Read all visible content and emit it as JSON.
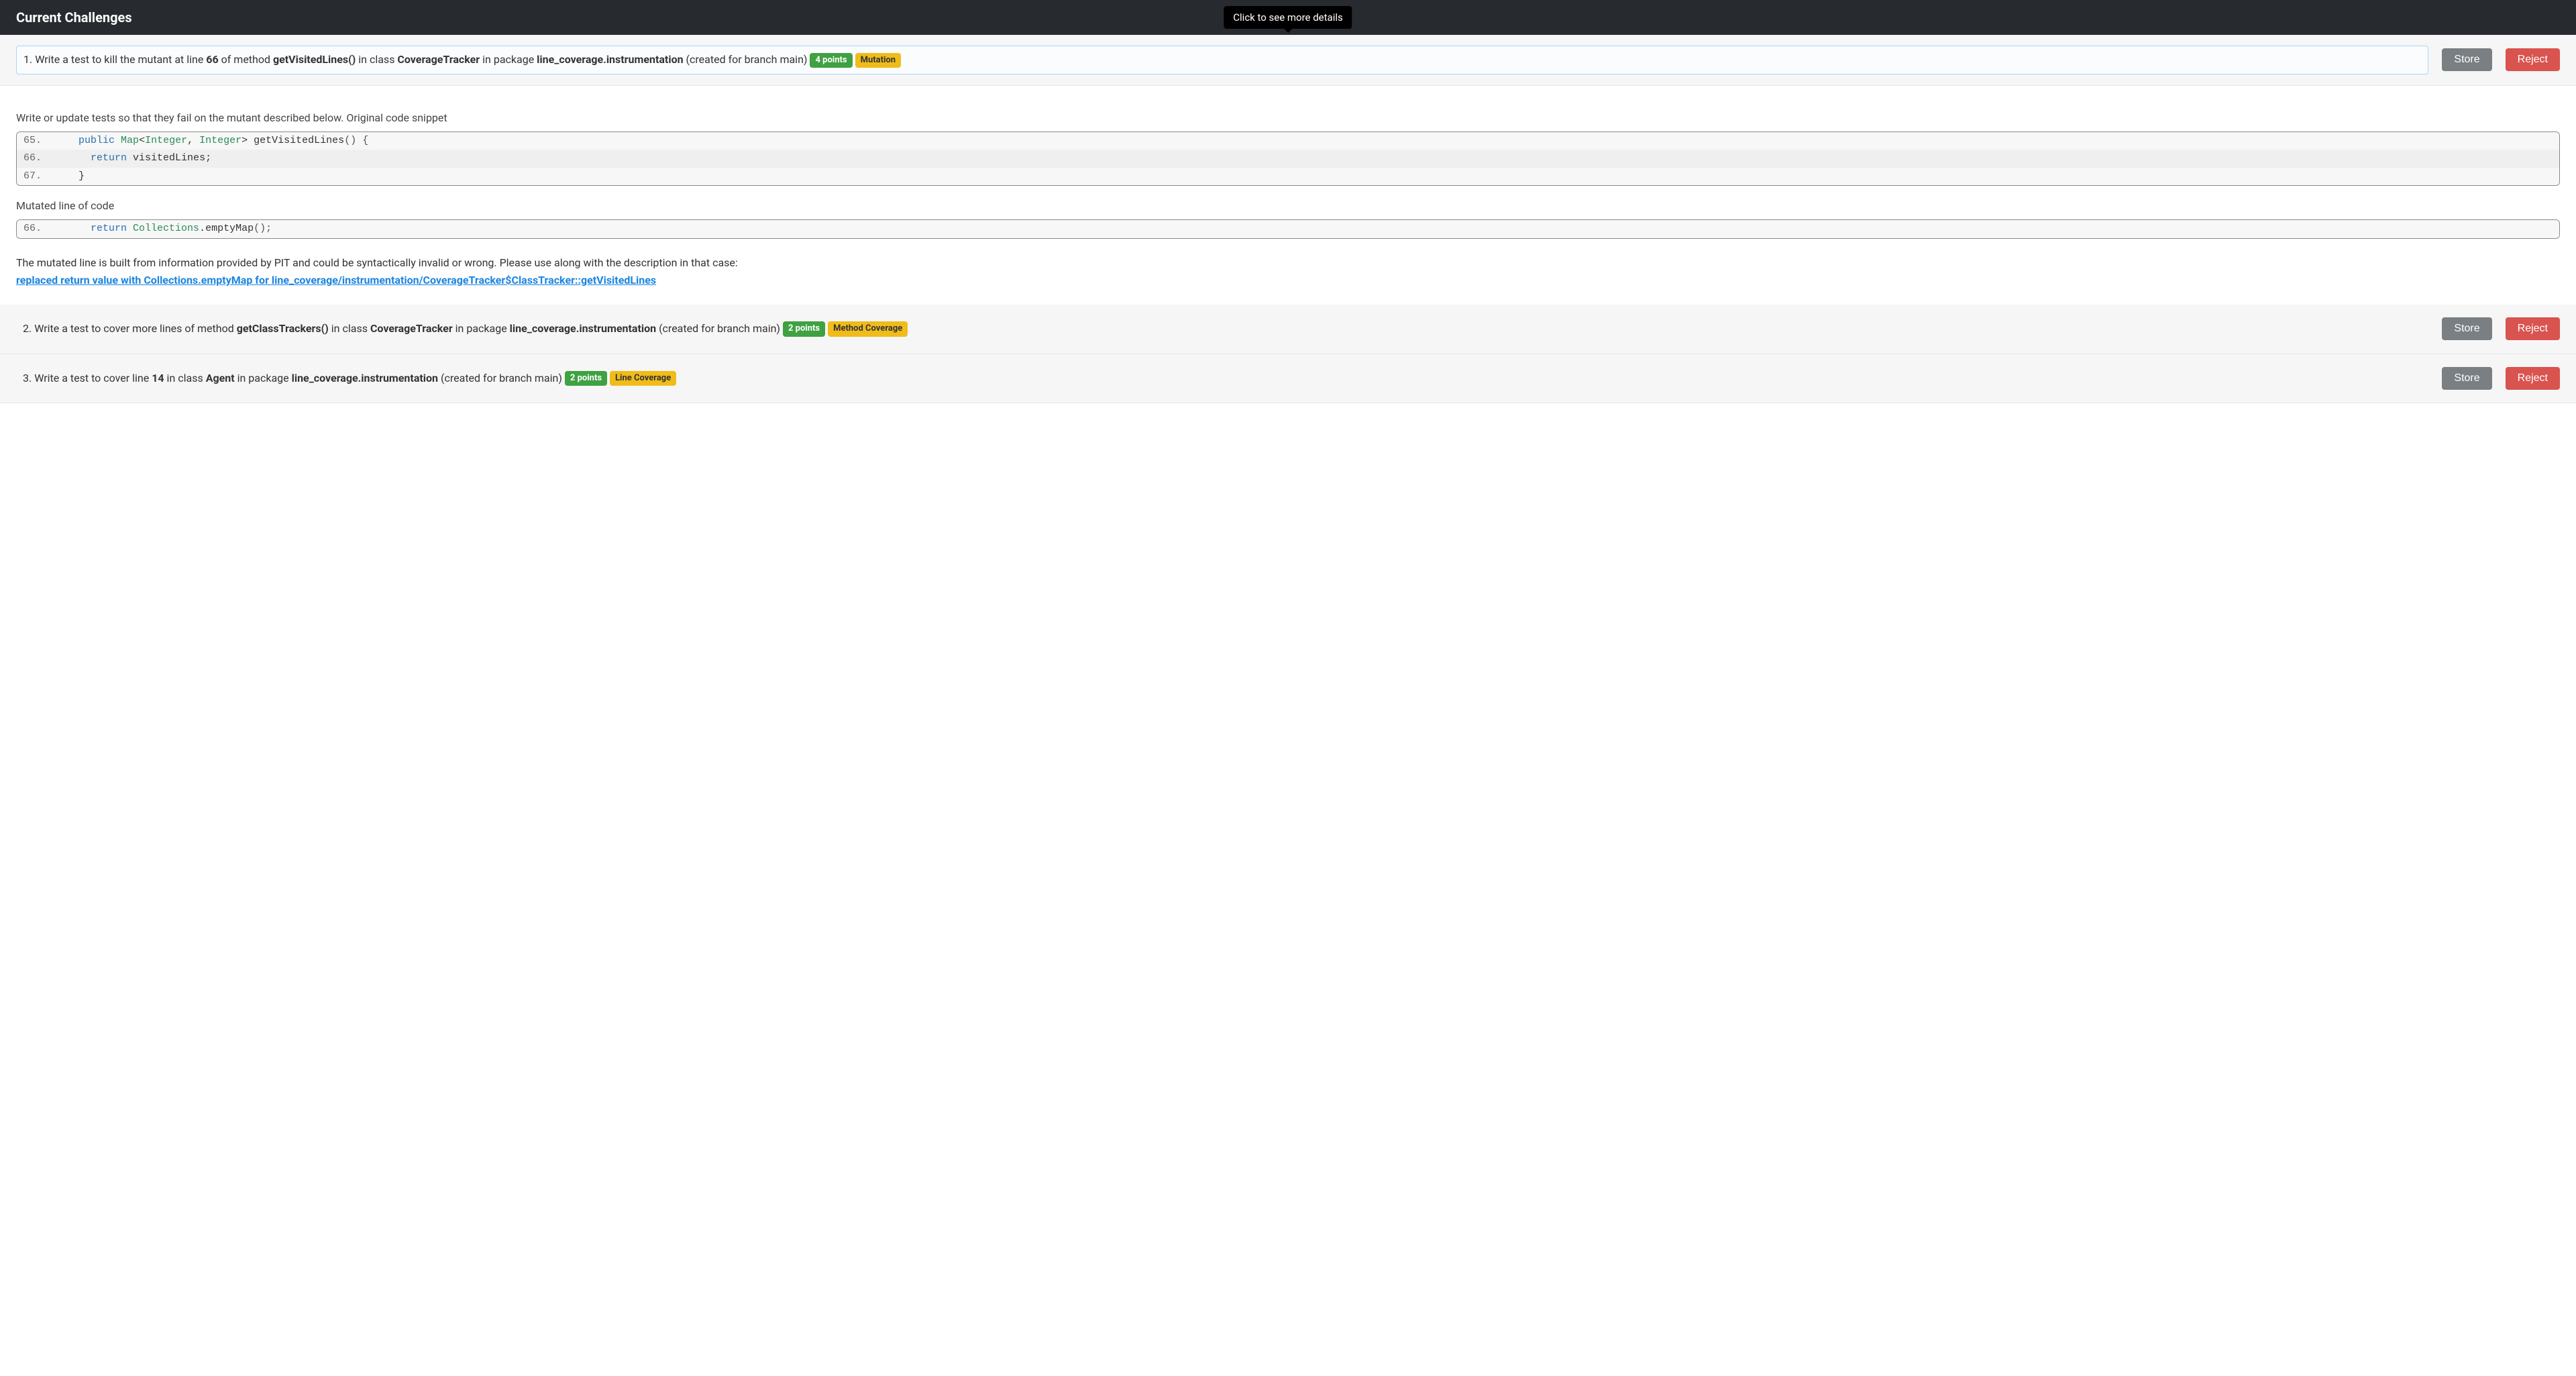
{
  "header": {
    "title": "Current Challenges",
    "tooltip": "Click to see more details"
  },
  "buttons": {
    "store": "Store",
    "reject": "Reject"
  },
  "challenges": [
    {
      "num": "1.",
      "prefix": "Write a test to kill the mutant at line ",
      "line_no": "66",
      "mid1": " of method ",
      "method": "getVisitedLines()",
      "mid2": " in class ",
      "class": "CoverageTracker",
      "mid3": " in package ",
      "package": "line_coverage.instrumentation",
      "suffix": " (created for branch main)",
      "points": "4 points",
      "tag": "Mutation"
    },
    {
      "num": "2.",
      "prefix": "Write a test to cover more lines of method ",
      "method": "getClassTrackers()",
      "mid2": " in class ",
      "class": "CoverageTracker",
      "mid3": " in package ",
      "package": "line_coverage.instrumentation",
      "suffix": " (created for branch main)",
      "points": "2 points",
      "tag": "Method Coverage"
    },
    {
      "num": "3.",
      "prefix": "Write a test to cover line ",
      "line_no": "14",
      "mid2": " in class ",
      "class": "Agent",
      "mid3": " in package ",
      "package": "line_coverage.instrumentation",
      "suffix": " (created for branch main)",
      "points": "2 points",
      "tag": "Line Coverage"
    }
  ],
  "details": {
    "intro": "Write or update tests so that they fail on the mutant described below. Original code snippet",
    "original_code": [
      {
        "ln": "65.",
        "indent": "    ",
        "kw1": "public",
        "sp1": " ",
        "type1": "Map",
        "lt": "<",
        "type2": "Integer",
        "comma": ", ",
        "type3": "Integer",
        "gt": ">",
        "sp2": " ",
        "name": "getVisitedLines",
        "paren": "() {"
      },
      {
        "ln": "66.",
        "indent": "      ",
        "kw1": "return",
        "sp1": " ",
        "name": "visitedLines",
        "tail": ";"
      },
      {
        "ln": "67.",
        "indent": "    ",
        "name": "}"
      }
    ],
    "mutated_heading": "Mutated line of code",
    "mutated_code": [
      {
        "ln": "66.",
        "indent": "      ",
        "kw1": "return",
        "sp1": " ",
        "type1": "Collections",
        "dot": ".",
        "name": "emptyMap",
        "paren": "();"
      }
    ],
    "disclaimer": "The mutated line is built from information provided by PIT and could be syntactically invalid or wrong. Please use along with the description in that case:",
    "pit_description": "replaced return value with Collections.emptyMap for line_coverage/instrumentation/CoverageTracker$ClassTracker::getVisitedLines"
  }
}
